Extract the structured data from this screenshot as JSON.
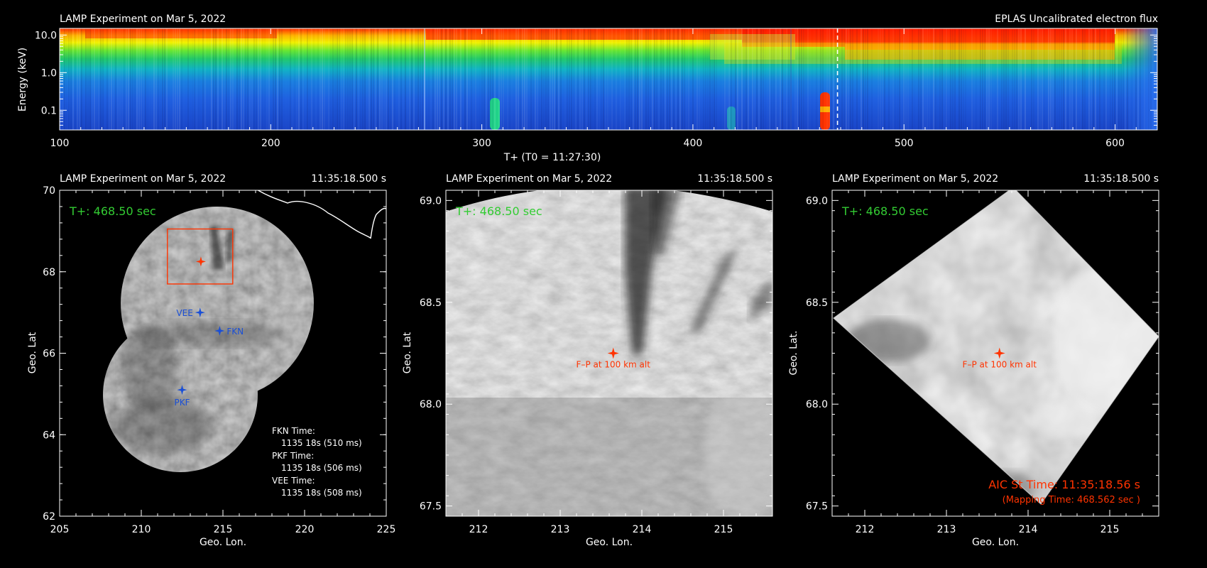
{
  "colors": {
    "background": "#000000",
    "axis": "#ffffff",
    "timestamp": "#33cc33",
    "marker": "#ff3300",
    "station": "#1a4fd6",
    "fov_box": "#ff3300",
    "cursor": "#ffffff"
  },
  "spectrogram": {
    "title_left": "LAMP Experiment on Mar 5, 2022",
    "title_right": "EPLAS Uncalibrated electron flux",
    "ylabel": "Energy (keV)",
    "xlabel": "T+ (T0 = 11:27:30)",
    "x_ticks": [
      "100",
      "200",
      "300",
      "400",
      "500",
      "600"
    ],
    "y_ticks": [
      "10.0",
      "1.0",
      "0.1"
    ],
    "cursor_time": 468.5
  },
  "chart_data": [
    {
      "type": "heatmap",
      "title": "LAMP Experiment on Mar 5, 2022",
      "subtitle": "EPLAS Uncalibrated electron flux",
      "xlabel": "T+ (T0 = 11:27:30)",
      "ylabel": "Energy (keV)",
      "xlim": [
        100,
        620
      ],
      "ylim": [
        0.03,
        15
      ],
      "yscale": "log",
      "x_ticks": [
        100,
        200,
        300,
        400,
        500,
        600
      ],
      "y_ticks": [
        10.0,
        1.0,
        0.1
      ],
      "cursor_x": 468.5,
      "colormap": "rainbow (blue low, red high)"
    },
    {
      "type": "scatter",
      "title": "LAMP Experiment on Mar 5, 2022",
      "xlabel": "Geo. Lon.",
      "ylabel": "Geo. Lat",
      "xlim": [
        205,
        225
      ],
      "ylim": [
        62,
        70
      ],
      "points": [
        {
          "name": "VEE",
          "x": 213.6,
          "y": 67.0
        },
        {
          "name": "FKN",
          "x": 214.8,
          "y": 66.55
        },
        {
          "name": "PKF",
          "x": 212.5,
          "y": 65.1
        },
        {
          "name": "F-P",
          "x": 213.65,
          "y": 68.25
        }
      ]
    },
    {
      "type": "scatter",
      "title": "LAMP Experiment on Mar 5, 2022",
      "xlabel": "Geo. Lon.",
      "ylabel": "Geo. Lat",
      "xlim": [
        211.6,
        215.6
      ],
      "ylim": [
        67.45,
        69.05
      ],
      "points": [
        {
          "name": "F-P at 100 km alt",
          "x": 213.65,
          "y": 68.25
        }
      ]
    },
    {
      "type": "scatter",
      "title": "LAMP Experiment on Mar 5, 2022",
      "xlabel": "Geo. Lon.",
      "ylabel": "Geo. Lat.",
      "xlim": [
        211.6,
        215.6
      ],
      "ylim": [
        67.45,
        69.05
      ],
      "points": [
        {
          "name": "F-P at 100 km alt",
          "x": 213.65,
          "y": 68.25
        }
      ]
    }
  ],
  "panels": [
    {
      "title_left": "LAMP Experiment on Mar 5, 2022",
      "title_right": "11:35:18.500 s",
      "stamp": "T+: 468.50 sec",
      "xlabel": "Geo. Lon.",
      "ylabel": "Geo. Lat",
      "x_ticks": [
        "205",
        "210",
        "215",
        "220",
        "225"
      ],
      "y_ticks": [
        "70",
        "68",
        "66",
        "64",
        "62"
      ],
      "stations": [
        {
          "label": "VEE",
          "lon": 213.6,
          "lat": 67.0,
          "side": "left"
        },
        {
          "label": "FKN",
          "lon": 214.8,
          "lat": 66.55,
          "side": "right"
        },
        {
          "label": "PKF",
          "lon": 212.5,
          "lat": 65.1,
          "side": "below"
        }
      ],
      "footpoint": {
        "lon": 213.65,
        "lat": 68.25
      },
      "times": [
        {
          "name": "FKN Time:",
          "value": "1135 18s (510 ms)"
        },
        {
          "name": "PKF Time:",
          "value": "1135 18s (506 ms)"
        },
        {
          "name": "VEE Time:",
          "value": "1135 18s (508 ms)"
        }
      ]
    },
    {
      "title_left": "LAMP Experiment on Mar 5, 2022",
      "title_right": "11:35:18.500 s",
      "stamp": "T+: 468.50 sec",
      "xlabel": "Geo. Lon.",
      "ylabel": "Geo. Lat",
      "x_ticks": [
        "212",
        "213",
        "214",
        "215"
      ],
      "y_ticks": [
        "69.0",
        "68.5",
        "68.0",
        "67.5"
      ],
      "marker_label": "F–P at 100 km alt"
    },
    {
      "title_left": "LAMP Experiment on Mar 5, 2022",
      "title_right": "11:35:18.500 s",
      "stamp": "T+: 468.50 sec",
      "xlabel": "Geo. Lon.",
      "ylabel": "Geo. Lat.",
      "x_ticks": [
        "212",
        "213",
        "214",
        "215"
      ],
      "y_ticks": [
        "69.0",
        "68.5",
        "68.0",
        "67.5"
      ],
      "marker_label": "F–P at 100 km alt",
      "aic_time": "AIC St Time: 11:35:18.56 s",
      "mapping_time": "(Mapping Time: 468.562 sec )"
    }
  ]
}
